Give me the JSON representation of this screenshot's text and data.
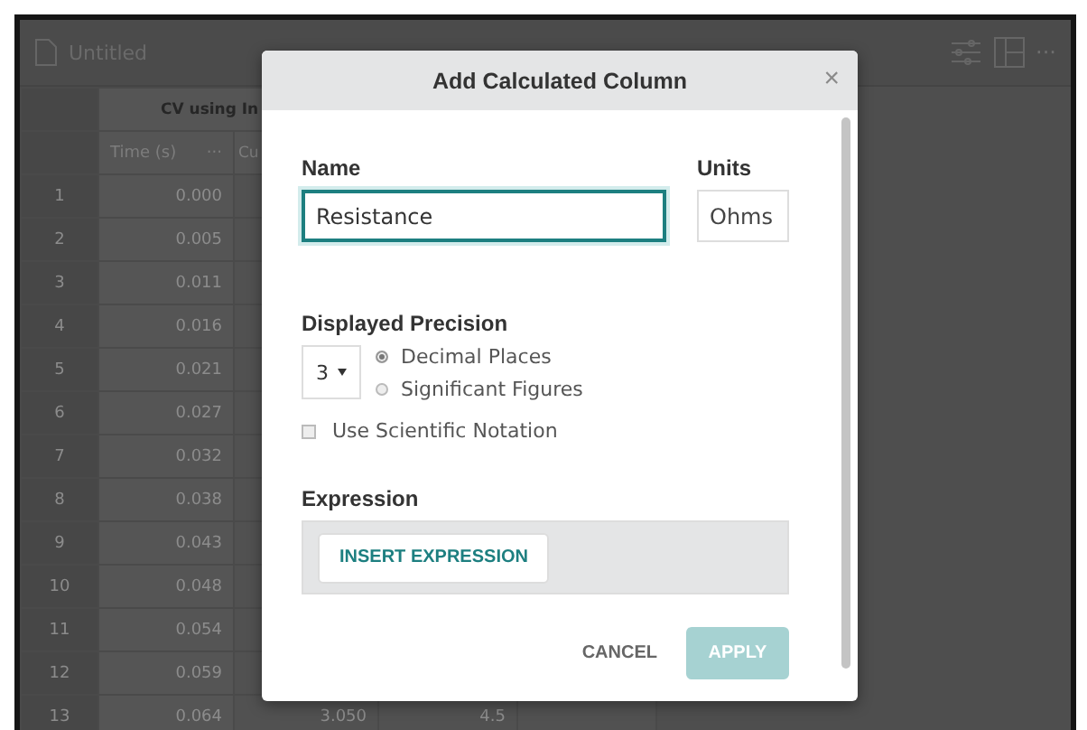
{
  "app": {
    "document_title": "Untitled"
  },
  "table": {
    "group_header": "CV using In",
    "columns": [
      "Time (s)",
      "Cu"
    ],
    "column_menu": "···",
    "rows": [
      {
        "index": "1",
        "time": "0.000"
      },
      {
        "index": "2",
        "time": "0.005"
      },
      {
        "index": "3",
        "time": "0.011"
      },
      {
        "index": "4",
        "time": "0.016"
      },
      {
        "index": "5",
        "time": "0.021"
      },
      {
        "index": "6",
        "time": "0.027"
      },
      {
        "index": "7",
        "time": "0.032"
      },
      {
        "index": "8",
        "time": "0.038"
      },
      {
        "index": "9",
        "time": "0.043"
      },
      {
        "index": "10",
        "time": "0.048"
      },
      {
        "index": "11",
        "time": "0.054"
      },
      {
        "index": "12",
        "time": "0.059"
      },
      {
        "index": "13",
        "time": "0.064",
        "column_3": "3.050",
        "column_4": "4.5"
      }
    ]
  },
  "dialog": {
    "title": "Add Calculated Column",
    "close": "×",
    "name_label": "Name",
    "name_value": "Resistance",
    "units_label": "Units",
    "units_value": "Ohms",
    "precision_label": "Displayed Precision",
    "precision_value": "3",
    "precision_options": [
      {
        "label": "Decimal Places",
        "selected": true
      },
      {
        "label": "Significant Figures",
        "selected": false
      }
    ],
    "scientific": {
      "label": "Use Scientific Notation",
      "checked": false
    },
    "expression_label": "Expression",
    "insert_button": "INSERT EXPRESSION",
    "cancel": "CANCEL",
    "apply": {
      "label": "APPLY",
      "disabled": true
    }
  }
}
